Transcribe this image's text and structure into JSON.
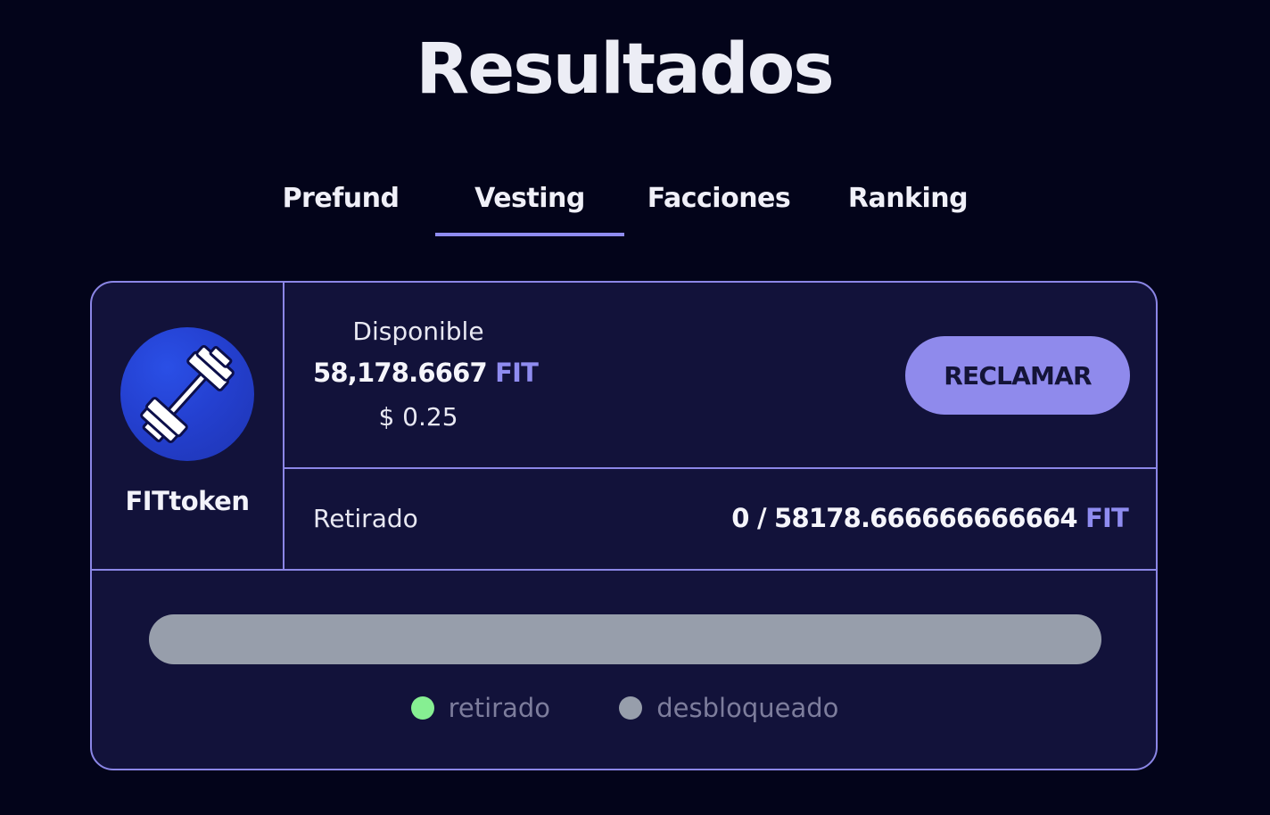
{
  "page": {
    "title": "Resultados"
  },
  "tabs": [
    {
      "label": "Prefund",
      "active": false
    },
    {
      "label": "Vesting",
      "active": true
    },
    {
      "label": "Facciones",
      "active": false
    },
    {
      "label": "Ranking",
      "active": false
    }
  ],
  "token": {
    "name": "FITtoken",
    "icon": "dumbbell-icon"
  },
  "available": {
    "label": "Disponible",
    "amount": "58,178.6667",
    "unit": "FIT",
    "usd": "$ 0.25"
  },
  "claim": {
    "label": "RECLAMAR"
  },
  "withdrawn": {
    "label": "Retirado",
    "value": "0 / 58178.666666666664",
    "unit": "FIT"
  },
  "progress": {
    "withdrawn_fraction": 0
  },
  "legend": [
    {
      "label": "retirado",
      "color": "#86ef92"
    },
    {
      "label": "desbloqueado",
      "color": "#979eab"
    }
  ],
  "colors": {
    "background": "#03041a",
    "card": "#12123a",
    "accent": "#8f8cf0",
    "border": "#8b86e6"
  }
}
